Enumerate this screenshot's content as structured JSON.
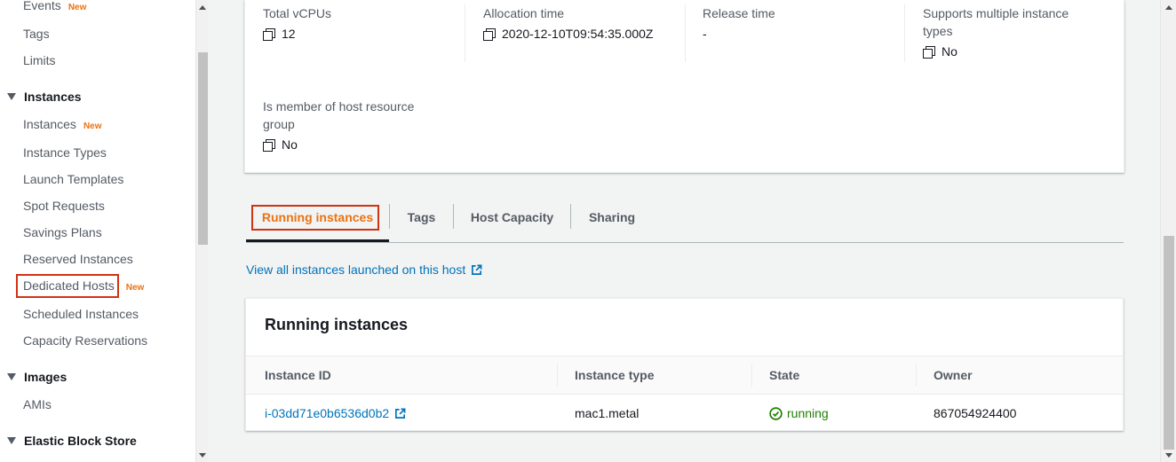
{
  "sidebar": {
    "items": [
      {
        "label": "Events",
        "badge": "New"
      },
      {
        "label": "Tags",
        "badge": ""
      },
      {
        "label": "Limits",
        "badge": ""
      }
    ],
    "instances_section": {
      "title": "Instances",
      "items": [
        {
          "label": "Instances",
          "badge": "New"
        },
        {
          "label": "Instance Types",
          "badge": ""
        },
        {
          "label": "Launch Templates",
          "badge": ""
        },
        {
          "label": "Spot Requests",
          "badge": ""
        },
        {
          "label": "Savings Plans",
          "badge": ""
        },
        {
          "label": "Reserved Instances",
          "badge": ""
        },
        {
          "label": "Dedicated Hosts",
          "badge": "New"
        },
        {
          "label": "Scheduled Instances",
          "badge": ""
        },
        {
          "label": "Capacity Reservations",
          "badge": ""
        }
      ]
    },
    "images_section": {
      "title": "Images",
      "items": [
        {
          "label": "AMIs"
        }
      ]
    },
    "ebs_section": {
      "title": "Elastic Block Store"
    }
  },
  "details": {
    "total_vcpus": {
      "label": "Total vCPUs",
      "value": "12"
    },
    "allocation_time": {
      "label": "Allocation time",
      "value": "2020-12-10T09:54:35.000Z"
    },
    "release_time": {
      "label": "Release time",
      "value": "-"
    },
    "multi_instance": {
      "label": "Supports multiple instance types",
      "value": "No"
    },
    "host_resource_group": {
      "label": "Is member of host resource group",
      "value": "No"
    }
  },
  "tabs": [
    {
      "label": "Running instances",
      "active": true
    },
    {
      "label": "Tags"
    },
    {
      "label": "Host Capacity"
    },
    {
      "label": "Sharing"
    }
  ],
  "view_all_link": "View all instances launched on this host",
  "running_table": {
    "title": "Running instances",
    "columns": [
      "Instance ID",
      "Instance type",
      "State",
      "Owner"
    ],
    "rows": [
      {
        "instance_id": "i-03dd71e0b6536d0b2",
        "instance_type": "mac1.metal",
        "state": "running",
        "owner": "867054924400"
      }
    ]
  },
  "colors": {
    "accent": "#ec7211",
    "link": "#0073bb",
    "success": "#1d8102",
    "highlight": "#d13212"
  }
}
